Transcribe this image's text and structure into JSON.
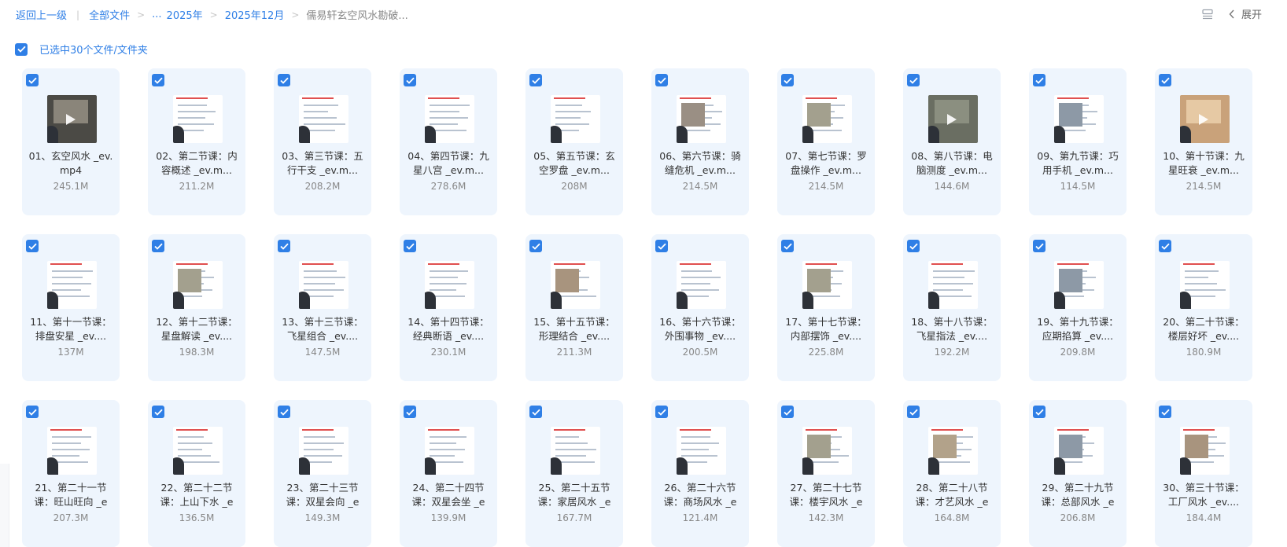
{
  "breadcrumb": {
    "back": "返回上一级",
    "all_files": "全部文件",
    "ellipsis": "...",
    "year": "2025年",
    "month": "2025年12月",
    "current": "儒易轩玄空风水勘破..."
  },
  "toolbar": {
    "expand": "展开"
  },
  "selection": {
    "label": "已选中30个文件/文件夹"
  },
  "files": [
    {
      "name": "01、玄空风水 _ev.mp4",
      "size": "245.1M"
    },
    {
      "name": "02、第二节课：内容概述 _ev.m...",
      "size": "211.2M"
    },
    {
      "name": "03、第三节课：五行干支 _ev.m...",
      "size": "208.2M"
    },
    {
      "name": "04、第四节课：九星八宫 _ev.m...",
      "size": "278.6M"
    },
    {
      "name": "05、第五节课：玄空罗盘 _ev.m...",
      "size": "208M"
    },
    {
      "name": "06、第六节课：骑缝危机 _ev.m...",
      "size": "214.5M"
    },
    {
      "name": "07、第七节课：罗盘操作 _ev.m...",
      "size": "214.5M"
    },
    {
      "name": "08、第八节课：电脑测度 _ev.m...",
      "size": "144.6M"
    },
    {
      "name": "09、第九节课：巧用手机 _ev.m...",
      "size": "114.5M"
    },
    {
      "name": "10、第十节课：九星旺衰 _ev.m...",
      "size": "214.5M"
    },
    {
      "name": "11、第十一节课：排盘安星 _ev....",
      "size": "137M"
    },
    {
      "name": "12、第十二节课：星盘解读 _ev....",
      "size": "198.3M"
    },
    {
      "name": "13、第十三节课：飞星组合 _ev....",
      "size": "147.5M"
    },
    {
      "name": "14、第十四节课：经典断语 _ev....",
      "size": "230.1M"
    },
    {
      "name": "15、第十五节课：形理结合 _ev....",
      "size": "211.3M"
    },
    {
      "name": "16、第十六节课：外围事物 _ev....",
      "size": "200.5M"
    },
    {
      "name": "17、第十七节课：内部摆饰 _ev....",
      "size": "225.8M"
    },
    {
      "name": "18、第十八节课：飞星指法 _ev....",
      "size": "192.2M"
    },
    {
      "name": "19、第十九节课：应期掐算 _ev....",
      "size": "209.8M"
    },
    {
      "name": "20、第二十节课：楼层好坏 _ev....",
      "size": "180.9M"
    },
    {
      "name": "21、第二十一节课：旺山旺向 _e",
      "size": "207.3M"
    },
    {
      "name": "22、第二十二节课：上山下水 _e",
      "size": "136.5M"
    },
    {
      "name": "23、第二十三节课：双星会向 _e",
      "size": "149.3M"
    },
    {
      "name": "24、第二十四节课：双星会坐 _e",
      "size": "139.9M"
    },
    {
      "name": "25、第二十五节课：家居风水 _e",
      "size": "167.7M"
    },
    {
      "name": "26、第二十六节课：商场风水 _e",
      "size": "121.4M"
    },
    {
      "name": "27、第二十七节课：楼宇风水 _e",
      "size": "142.3M"
    },
    {
      "name": "28、第二十八节课：才艺风水 _e",
      "size": "164.8M"
    },
    {
      "name": "29、第二十九节课：总部风水 _e",
      "size": "206.8M"
    },
    {
      "name": "30、第三十节课：工厂风水 _ev....",
      "size": "184.4M"
    }
  ],
  "colors": {
    "accent": "#2f7fe6",
    "card_bg": "#eef5fd"
  }
}
